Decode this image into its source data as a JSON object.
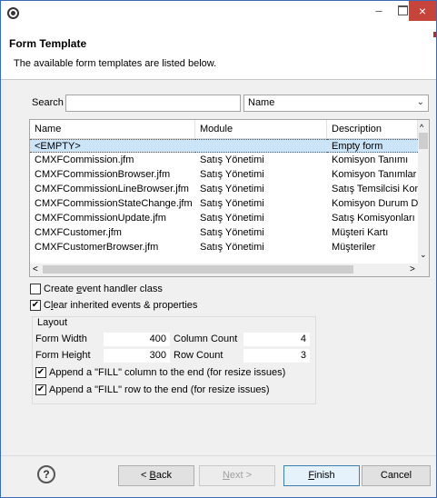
{
  "window": {
    "icon": "eclipse-gear-icon",
    "controls": {
      "minimize": "–",
      "close": "×"
    }
  },
  "header": {
    "title": "Form Template",
    "description": "The available form templates are listed below."
  },
  "search": {
    "label": "Search",
    "value": "",
    "field_select": "Name",
    "field_arrow": "⌄"
  },
  "table": {
    "columns": [
      "Name",
      "Module",
      "Description"
    ],
    "rows": [
      {
        "name": "<EMPTY>",
        "module": "",
        "description": "Empty form",
        "selected": true
      },
      {
        "name": "CMXFCommission.jfm",
        "module": "Satış Yönetimi",
        "description": "Komisyon Tanımı"
      },
      {
        "name": "CMXFCommissionBrowser.jfm",
        "module": "Satış Yönetimi",
        "description": "Komisyon Tanımlar"
      },
      {
        "name": "CMXFCommissionLineBrowser.jfm",
        "module": "Satış Yönetimi",
        "description": "Satış Temsilcisi Kon"
      },
      {
        "name": "CMXFCommissionStateChange.jfm",
        "module": "Satış Yönetimi",
        "description": "Komisyon Durum D"
      },
      {
        "name": "CMXFCommissionUpdate.jfm",
        "module": "Satış Yönetimi",
        "description": "Satış Komisyonları G"
      },
      {
        "name": "CMXFCustomer.jfm",
        "module": "Satış Yönetimi",
        "description": "Müşteri Kartı"
      },
      {
        "name": "CMXFCustomerBrowser.jfm",
        "module": "Satış Yönetimi",
        "description": "Müşteriler"
      }
    ],
    "scroll": {
      "up": "^",
      "down": "⌄",
      "left": "<",
      "right": ">"
    }
  },
  "options": {
    "create_event_handler": {
      "pre": "Create ",
      "key": "e",
      "post": "vent handler class",
      "checked": false
    },
    "clear_inherited": {
      "pre": "C",
      "key": "l",
      "post": "ear inherited events & properties",
      "checked": true
    }
  },
  "layout": {
    "legend": "Layout",
    "form_width_label": "Form Width",
    "form_width": "400",
    "form_height_label": "Form Height",
    "form_height": "300",
    "column_count_label": "Column Count",
    "column_count": "4",
    "row_count_label": "Row Count",
    "row_count": "3",
    "append_fill_column": {
      "label": "Append a \"FILL\" column to the end (for resize issues)",
      "checked": true
    },
    "append_fill_row": {
      "label": "Append a \"FILL\" row to the end (for resize issues)",
      "checked": true
    }
  },
  "buttons": {
    "help": "?",
    "back": {
      "pre": "< ",
      "key": "B",
      "post": "ack"
    },
    "next": {
      "pre": "",
      "key": "N",
      "post": "ext >"
    },
    "finish": {
      "pre": "",
      "key": "F",
      "post": "inish"
    },
    "cancel": "Cancel"
  },
  "colors": {
    "selection": "#cce4f7",
    "close_button": "#c7443a",
    "window_border": "#3c6bb5"
  }
}
